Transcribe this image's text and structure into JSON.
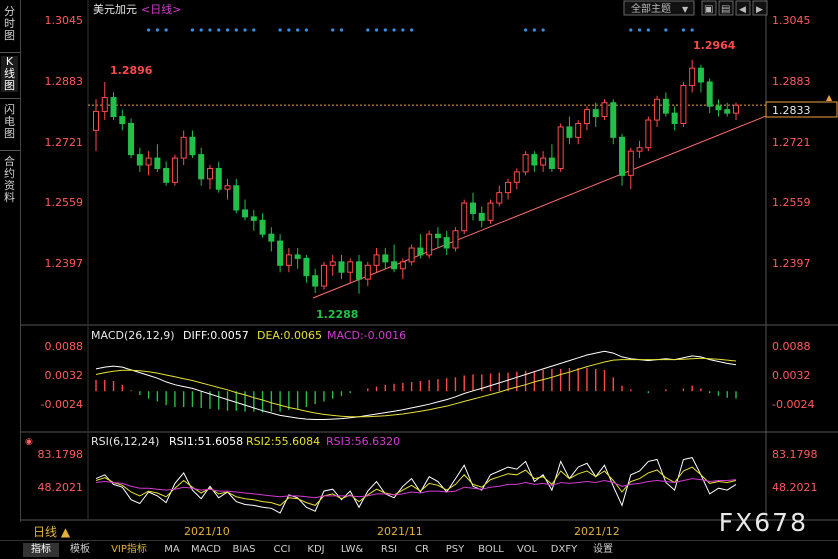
{
  "instrument": "美元加元",
  "period_label": "<日线>",
  "toolbar": {
    "theme_label": "全部主题",
    "theme_arrow": "▼",
    "btn_a": "▣",
    "btn_b": "▤",
    "btn_c": "◀",
    "btn_d": "▶"
  },
  "sidebar": {
    "tabs": [
      {
        "label": "分时图",
        "active": false
      },
      {
        "label": "K线图",
        "active": true
      },
      {
        "label": "闪电图",
        "active": false
      },
      {
        "label": "合约资料",
        "active": false
      }
    ]
  },
  "main_axis": {
    "ticks": [
      "1.3045",
      "1.2883",
      "1.2721",
      "1.2559",
      "1.2397"
    ],
    "current_price": "1.2833"
  },
  "annotations": {
    "high": "1.2896",
    "high2": "1.2964",
    "low": "1.2288"
  },
  "macd": {
    "title": "MACD(26,12,9)",
    "diff": "DIFF:0.0057",
    "dea": "DEA:0.0065",
    "macd": "MACD:-0.0016",
    "ticks": [
      "0.0088",
      "0.0032",
      "-0.0024"
    ]
  },
  "rsi": {
    "title": "RSI(6,12,24)",
    "rsi1": "RSI1:51.6058",
    "rsi2": "RSI2:55.6084",
    "rsi3": "RSI3:56.6320",
    "ticks": [
      "83.1798",
      "48.2021"
    ]
  },
  "xaxis": {
    "labels": [
      "2021/10",
      "2021/11",
      "2021/12"
    ],
    "period_button": "日线 ▲"
  },
  "bottom_tabs": [
    "指标",
    "模板",
    "VIP指标",
    "MA",
    "MACD",
    "BIAS",
    "CCI",
    "KDJ",
    "LW&",
    "RSI",
    "CR",
    "PSY",
    "BOLL",
    "VOL",
    "DXFY",
    "设置"
  ],
  "watermark": "FX678",
  "colors": {
    "up": "#ff4a4a",
    "down": "#22c04a",
    "diff": "#ffffff",
    "dea": "#e6e033",
    "rsi3": "#d23bd2",
    "accent": "#e3b23c",
    "trendline": "#ff6e6e"
  },
  "chart_data": {
    "type": "candlestick",
    "price_range": [
      1.2235,
      1.3085
    ],
    "reference_level": 1.2833,
    "candles": [
      [
        1.276,
        1.285,
        1.27,
        1.2815
      ],
      [
        1.2815,
        1.29,
        1.279,
        1.2855
      ],
      [
        1.2855,
        1.287,
        1.279,
        1.28
      ],
      [
        1.28,
        1.282,
        1.276,
        1.278
      ],
      [
        1.278,
        1.2795,
        1.268,
        1.269
      ],
      [
        1.269,
        1.271,
        1.264,
        1.266
      ],
      [
        1.266,
        1.27,
        1.263,
        1.268
      ],
      [
        1.268,
        1.272,
        1.264,
        1.265
      ],
      [
        1.265,
        1.267,
        1.26,
        1.261
      ],
      [
        1.261,
        1.269,
        1.26,
        1.268
      ],
      [
        1.268,
        1.276,
        1.266,
        1.274
      ],
      [
        1.274,
        1.276,
        1.268,
        1.269
      ],
      [
        1.269,
        1.271,
        1.26,
        1.262
      ],
      [
        1.262,
        1.266,
        1.259,
        1.265
      ],
      [
        1.265,
        1.267,
        1.258,
        1.259
      ],
      [
        1.259,
        1.262,
        1.256,
        1.26
      ],
      [
        1.26,
        1.262,
        1.252,
        1.253
      ],
      [
        1.253,
        1.256,
        1.25,
        1.251
      ],
      [
        1.251,
        1.253,
        1.247,
        1.25
      ],
      [
        1.25,
        1.252,
        1.245,
        1.246
      ],
      [
        1.246,
        1.248,
        1.241,
        1.244
      ],
      [
        1.244,
        1.246,
        1.235,
        1.237
      ],
      [
        1.237,
        1.242,
        1.235,
        1.24
      ],
      [
        1.24,
        1.242,
        1.236,
        1.239
      ],
      [
        1.239,
        1.24,
        1.232,
        1.234
      ],
      [
        1.234,
        1.236,
        1.229,
        1.231
      ],
      [
        1.231,
        1.238,
        1.23,
        1.237
      ],
      [
        1.237,
        1.24,
        1.234,
        1.238
      ],
      [
        1.238,
        1.24,
        1.233,
        1.235
      ],
      [
        1.235,
        1.239,
        1.232,
        1.238
      ],
      [
        1.238,
        1.24,
        1.2288,
        1.233
      ],
      [
        1.233,
        1.238,
        1.231,
        1.237
      ],
      [
        1.237,
        1.242,
        1.235,
        1.24
      ],
      [
        1.24,
        1.242,
        1.236,
        1.238
      ],
      [
        1.238,
        1.243,
        1.235,
        1.236
      ],
      [
        1.236,
        1.239,
        1.233,
        1.238
      ],
      [
        1.238,
        1.243,
        1.237,
        1.242
      ],
      [
        1.242,
        1.246,
        1.239,
        1.24
      ],
      [
        1.24,
        1.247,
        1.239,
        1.246
      ],
      [
        1.246,
        1.248,
        1.242,
        1.245
      ],
      [
        1.245,
        1.247,
        1.24,
        1.242
      ],
      [
        1.242,
        1.248,
        1.241,
        1.247
      ],
      [
        1.247,
        1.256,
        1.246,
        1.255
      ],
      [
        1.255,
        1.258,
        1.25,
        1.252
      ],
      [
        1.252,
        1.254,
        1.248,
        1.25
      ],
      [
        1.25,
        1.256,
        1.249,
        1.255
      ],
      [
        1.255,
        1.26,
        1.254,
        1.258
      ],
      [
        1.258,
        1.262,
        1.256,
        1.261
      ],
      [
        1.261,
        1.265,
        1.259,
        1.264
      ],
      [
        1.264,
        1.27,
        1.263,
        1.269
      ],
      [
        1.269,
        1.27,
        1.264,
        1.266
      ],
      [
        1.266,
        1.27,
        1.264,
        1.268
      ],
      [
        1.268,
        1.272,
        1.264,
        1.265
      ],
      [
        1.265,
        1.278,
        1.264,
        1.277
      ],
      [
        1.277,
        1.28,
        1.272,
        1.274
      ],
      [
        1.274,
        1.279,
        1.272,
        1.278
      ],
      [
        1.278,
        1.283,
        1.276,
        1.282
      ],
      [
        1.282,
        1.284,
        1.277,
        1.28
      ],
      [
        1.28,
        1.285,
        1.279,
        1.284
      ],
      [
        1.284,
        1.285,
        1.272,
        1.274
      ],
      [
        1.274,
        1.275,
        1.26,
        1.263
      ],
      [
        1.263,
        1.271,
        1.259,
        1.27
      ],
      [
        1.27,
        1.273,
        1.268,
        1.271
      ],
      [
        1.271,
        1.28,
        1.27,
        1.279
      ],
      [
        1.279,
        1.286,
        1.277,
        1.285
      ],
      [
        1.285,
        1.287,
        1.28,
        1.281
      ],
      [
        1.281,
        1.283,
        1.276,
        1.278
      ],
      [
        1.278,
        1.29,
        1.277,
        1.289
      ],
      [
        1.289,
        1.2964,
        1.287,
        1.294
      ],
      [
        1.294,
        1.295,
        1.287,
        1.29
      ],
      [
        1.29,
        1.291,
        1.281,
        1.283
      ],
      [
        1.283,
        1.285,
        1.28,
        1.282
      ],
      [
        1.282,
        1.284,
        1.28,
        1.281
      ],
      [
        1.281,
        1.284,
        1.279,
        1.2833
      ]
    ],
    "macd_diff": [
      0.0048,
      0.0052,
      0.0054,
      0.0052,
      0.0046,
      0.004,
      0.0034,
      0.0028,
      0.002,
      0.0014,
      0.001,
      0.0006,
      0.0,
      -0.0006,
      -0.0012,
      -0.0018,
      -0.0024,
      -0.003,
      -0.0036,
      -0.0042,
      -0.0047,
      -0.0052,
      -0.0055,
      -0.0058,
      -0.006,
      -0.0061,
      -0.0061,
      -0.006,
      -0.0059,
      -0.0057,
      -0.0055,
      -0.0052,
      -0.0049,
      -0.0046,
      -0.0043,
      -0.004,
      -0.0036,
      -0.0032,
      -0.0028,
      -0.0023,
      -0.0018,
      -0.0012,
      -0.0005,
      0.0001,
      0.0006,
      0.0012,
      0.0018,
      0.0024,
      0.003,
      0.0036,
      0.0042,
      0.0048,
      0.0054,
      0.006,
      0.0066,
      0.0072,
      0.0078,
      0.0082,
      0.0086,
      0.0082,
      0.0074,
      0.007,
      0.0068,
      0.0066,
      0.0068,
      0.007,
      0.0068,
      0.0072,
      0.0076,
      0.0074,
      0.0068,
      0.0064,
      0.006,
      0.0057
    ],
    "macd_dea": [
      0.0036,
      0.004,
      0.0043,
      0.0045,
      0.0045,
      0.0044,
      0.0042,
      0.0039,
      0.0035,
      0.0031,
      0.0027,
      0.0023,
      0.0018,
      0.0013,
      0.0008,
      0.0003,
      -0.0003,
      -0.0008,
      -0.0014,
      -0.0019,
      -0.0025,
      -0.003,
      -0.0035,
      -0.0039,
      -0.0043,
      -0.0047,
      -0.005,
      -0.0052,
      -0.0054,
      -0.0055,
      -0.0055,
      -0.0055,
      -0.0054,
      -0.0053,
      -0.0051,
      -0.0049,
      -0.0046,
      -0.0043,
      -0.004,
      -0.0036,
      -0.0032,
      -0.0027,
      -0.0022,
      -0.0017,
      -0.0012,
      -0.0007,
      -0.0002,
      0.0004,
      0.0009,
      0.0014,
      0.002,
      0.0025,
      0.003,
      0.0036,
      0.0041,
      0.0047,
      0.0053,
      0.0058,
      0.0063,
      0.0067,
      0.0068,
      0.0068,
      0.0068,
      0.0068,
      0.0068,
      0.0068,
      0.0068,
      0.0069,
      0.007,
      0.0071,
      0.007,
      0.0069,
      0.0067,
      0.0065
    ],
    "macd_range": [
      -0.0062,
      0.0106
    ],
    "rsi1": [
      58,
      62,
      52,
      49,
      36,
      32,
      44,
      40,
      33,
      53,
      64,
      46,
      37,
      50,
      38,
      44,
      34,
      31,
      30,
      28,
      27,
      22,
      41,
      38,
      28,
      24,
      45,
      47,
      36,
      45,
      28,
      45,
      55,
      42,
      38,
      50,
      58,
      44,
      60,
      55,
      44,
      58,
      72,
      50,
      46,
      62,
      66,
      70,
      68,
      76,
      55,
      62,
      46,
      76,
      58,
      70,
      74,
      60,
      72,
      50,
      30,
      62,
      66,
      76,
      78,
      54,
      46,
      78,
      80,
      62,
      42,
      48,
      46,
      52
    ],
    "rsi2": [
      56,
      59,
      54,
      51,
      44,
      40,
      45,
      43,
      39,
      48,
      56,
      49,
      43,
      48,
      42,
      44,
      39,
      37,
      36,
      34,
      33,
      30,
      38,
      37,
      33,
      30,
      40,
      42,
      37,
      41,
      34,
      41,
      47,
      43,
      41,
      46,
      51,
      45,
      53,
      51,
      46,
      52,
      62,
      52,
      49,
      57,
      60,
      63,
      62,
      67,
      58,
      60,
      52,
      66,
      58,
      63,
      66,
      60,
      66,
      56,
      44,
      55,
      58,
      64,
      67,
      59,
      54,
      66,
      70,
      62,
      53,
      55,
      54,
      56
    ],
    "rsi3": [
      54,
      55,
      54,
      53,
      50,
      48,
      48,
      47,
      46,
      47,
      49,
      48,
      46,
      47,
      45,
      45,
      44,
      43,
      42,
      41,
      40,
      39,
      40,
      40,
      39,
      38,
      40,
      40,
      40,
      40,
      39,
      40,
      42,
      42,
      41,
      42,
      44,
      43,
      45,
      45,
      44,
      45,
      49,
      48,
      47,
      49,
      50,
      52,
      52,
      54,
      52,
      53,
      51,
      54,
      53,
      54,
      55,
      54,
      56,
      54,
      50,
      52,
      53,
      55,
      56,
      55,
      54,
      56,
      58,
      57,
      55,
      56,
      56,
      57
    ],
    "rsi_range": [
      20,
      90
    ]
  }
}
